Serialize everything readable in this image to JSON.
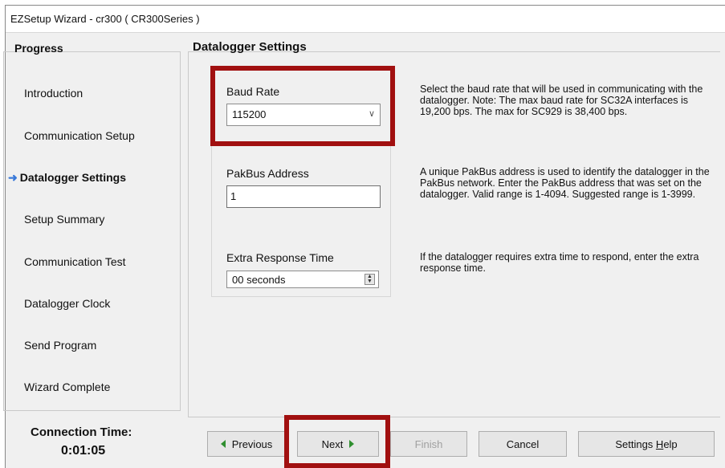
{
  "window": {
    "title": "EZSetup Wizard - cr300 ( CR300Series )"
  },
  "progress": {
    "header": "Progress",
    "steps": [
      {
        "label": "Introduction"
      },
      {
        "label": "Communication Setup"
      },
      {
        "label": "Datalogger Settings",
        "active": true
      },
      {
        "label": "Setup Summary"
      },
      {
        "label": "Communication Test"
      },
      {
        "label": "Datalogger Clock"
      },
      {
        "label": "Send Program"
      },
      {
        "label": "Wizard Complete"
      }
    ],
    "connection_label": "Connection Time:",
    "connection_time": "0:01:05"
  },
  "settings": {
    "header": "Datalogger Settings",
    "baud": {
      "label": "Baud Rate",
      "value": "115200",
      "help": "Select the baud rate that will be used in communicating with the datalogger. Note: The max baud rate for SC32A interfaces is 19,200 bps. The max for SC929 is 38,400 bps."
    },
    "pakbus": {
      "label": "PakBus Address",
      "value": "1",
      "help": "A unique PakBus address is used to identify the datalogger in the PakBus network.  Enter the PakBus address that was set on the datalogger. Valid range is 1-4094.  Suggested range is 1-3999."
    },
    "response": {
      "label": "Extra Response Time",
      "value": "00 seconds",
      "help": "If the datalogger requires extra time to respond, enter the extra response time."
    }
  },
  "buttons": {
    "previous": "Previous",
    "next": "Next",
    "finish": "Finish",
    "cancel": "Cancel",
    "help_prefix": "Settings ",
    "help_underlined": "H",
    "help_suffix": "elp"
  },
  "colors": {
    "highlight": "#a11010",
    "arrow": "#3b7ad9",
    "nav_triangle": "#2f8f2f"
  },
  "icons": {
    "active_step": "right-arrow-icon",
    "select": "chevron-down-icon",
    "spinner": "up-down-spinner-icon"
  }
}
